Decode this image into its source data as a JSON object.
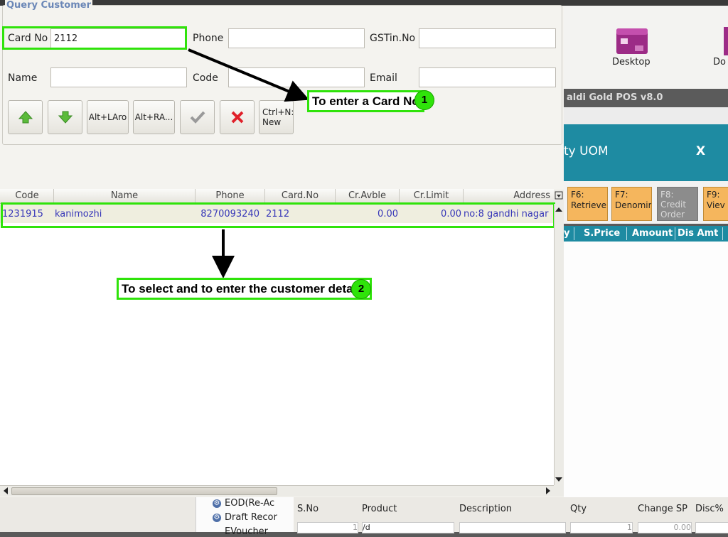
{
  "dialog": {
    "legend": "Query Customer",
    "fields": {
      "card_no_label": "Card No",
      "card_no_value": "2112",
      "phone_label": "Phone",
      "phone_value": "",
      "gstin_label": "GSTin.No",
      "gstin_value": "",
      "name_label": "Name",
      "name_value": "",
      "code_label": "Code",
      "code_value": "",
      "email_label": "Email",
      "email_value": ""
    },
    "toolbar": {
      "alt_left": "Alt+LAro",
      "alt_right": "Alt+RA...",
      "new_line1": "Ctrl+N:",
      "new_line2": "New"
    },
    "grid": {
      "columns": [
        "Code",
        "Name",
        "Phone",
        "Card.No",
        "Cr.Avble",
        "Cr.Limit",
        "Address"
      ],
      "rows": [
        {
          "code": "1231915",
          "name": "kanimozhi",
          "phone": "8270093240",
          "card_no": "2112",
          "cr_avble": "0.00",
          "cr_limit": "0.00",
          "address": "no:8 gandhi nagar"
        }
      ]
    }
  },
  "annotations": {
    "step1_text": "To enter a Card No",
    "step1_num": "1",
    "step2_text": "To select and to enter the customer details",
    "step2_num": "2",
    "color": "#2fe30a"
  },
  "desktop": {
    "icon1_label": "Desktop",
    "icon2_label": "Do"
  },
  "pos": {
    "title": "aldi Gold POS v8.0",
    "header_title": "ty UOM",
    "close_label": "X",
    "keys": [
      {
        "line1": "F6:",
        "line2": "Retrieve"
      },
      {
        "line1": "F7:",
        "line2": "Denomir"
      },
      {
        "line1": "F8:",
        "line2": "Credit",
        "line3": "Order"
      },
      {
        "line1": "F9:",
        "line2": "Viev"
      }
    ],
    "columns": [
      "y",
      "S.Price",
      "Amount",
      "Dis Amt"
    ]
  },
  "bottom": {
    "tree": [
      "EOD(Re-Ac",
      "Draft Recor",
      "EVoucher"
    ],
    "grid_headers": [
      "S.No",
      "Product",
      "Description",
      "Qty",
      "Change SP",
      "Disc%"
    ],
    "row_sno": "1",
    "row_product": "/d",
    "row_qty": "1",
    "row_change_sp": "0.00"
  }
}
